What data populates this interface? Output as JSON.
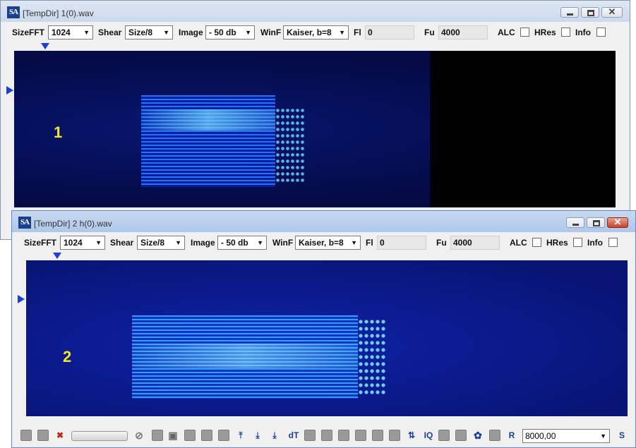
{
  "windows": [
    {
      "title": "[TempDir] 1(0).wav",
      "icon": "SA",
      "overlay_label": "1",
      "toolbar": {
        "sizefft_label": "SizeFFT",
        "sizefft_value": "1024",
        "shear_label": "Shear",
        "shear_value": "Size/8",
        "image_label": "Image",
        "image_value": "- 50 db",
        "winf_label": "WinF",
        "winf_value": "Kaiser, b=8",
        "fl_label": "Fl",
        "fl_value": "0",
        "fu_label": "Fu",
        "fu_value": "4000",
        "alc_label": "ALC",
        "hres_label": "HRes",
        "info_label": "Info"
      }
    },
    {
      "title": "[TempDir] 2 h(0).wav",
      "icon": "SA",
      "overlay_label": "2",
      "toolbar": {
        "sizefft_label": "SizeFFT",
        "sizefft_value": "1024",
        "shear_label": "Shear",
        "shear_value": "Size/8",
        "image_label": "Image",
        "image_value": "- 50 db",
        "winf_label": "WinF",
        "winf_value": "Kaiser, b=8",
        "fl_label": "Fl",
        "fl_value": "0",
        "fu_label": "Fu",
        "fu_value": "4000",
        "alc_label": "ALC",
        "hres_label": "HRes",
        "info_label": "Info"
      },
      "bottom_toolbar": {
        "dt_label": "dT",
        "iq_label": "IQ",
        "r_label": "R",
        "sample_rate_value": "8000,00",
        "s_label": "S"
      }
    }
  ],
  "colors": {
    "marker": "#1c3fd8",
    "overlay_text": "#f4e81c",
    "close_button": "#c7442b"
  }
}
